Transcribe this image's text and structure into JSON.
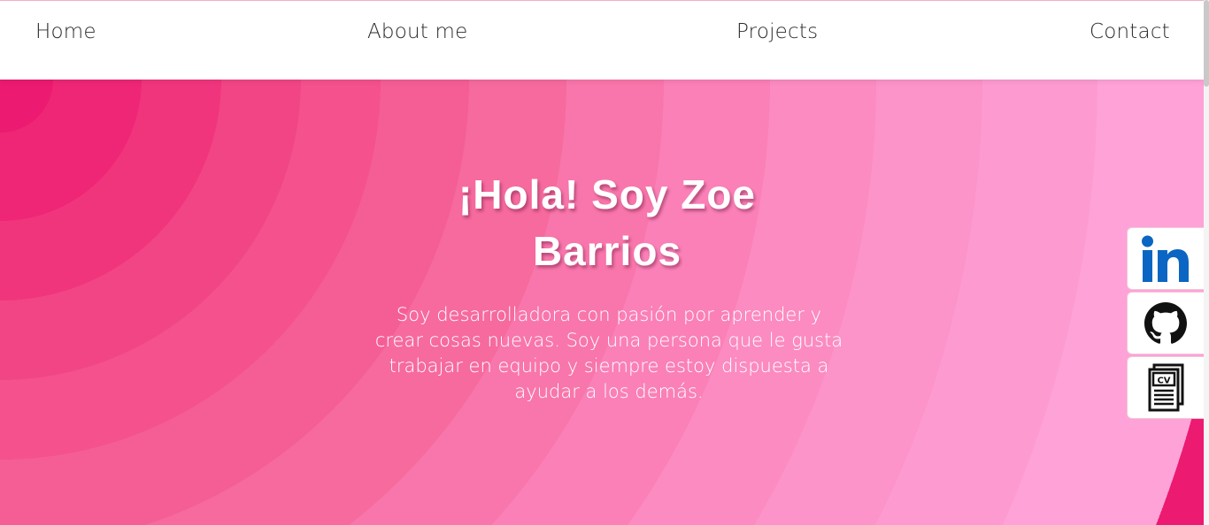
{
  "nav": {
    "home": "Home",
    "about": "About me",
    "projects": "Projects",
    "contact": "Contact"
  },
  "hero": {
    "title": "¡Hola! Soy Zoe Barrios",
    "description": "Soy desarrolladora con pasión por aprender y crear cosas nuevas. Soy una persona que le gusta trabajar en equipo y siempre estoy dispuesta a ayudar a los demás."
  },
  "social": {
    "linkedin_icon": "linkedin-icon",
    "github_icon": "github-icon",
    "cv_icon": "cv-document-icon",
    "cv_mark": "CV"
  },
  "colors": {
    "linkedin": "#0a66c2",
    "hero_start": "#ec1a70",
    "hero_end": "#fea2d8"
  }
}
